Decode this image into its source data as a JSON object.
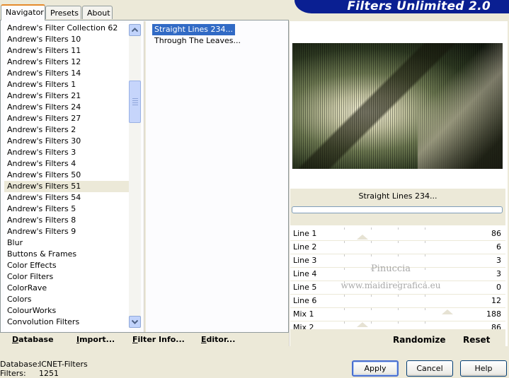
{
  "tabs": [
    {
      "label": "Navigator",
      "active": true
    },
    {
      "label": "Presets",
      "active": false
    },
    {
      "label": "About",
      "active": false
    }
  ],
  "banner_title": "Filters Unlimited 2.0",
  "categories": [
    "Andrew's Filter Collection 62",
    "Andrew's Filters 10",
    "Andrew's Filters 11",
    "Andrew's Filters 12",
    "Andrew's Filters 14",
    "Andrew's Filters 1",
    "Andrew's Filters 21",
    "Andrew's Filters 24",
    "Andrew's Filters 27",
    "Andrew's Filters 2",
    "Andrew's Filters 30",
    "Andrew's Filters 3",
    "Andrew's Filters 4",
    "Andrew's Filters 50",
    "Andrew's Filters 51",
    "Andrew's Filters 54",
    "Andrew's Filters 5",
    "Andrew's Filters 8",
    "Andrew's Filters 9",
    "Blur",
    "Buttons & Frames",
    "Color Effects",
    "Color Filters",
    "ColorRave",
    "Colors",
    "ColourWorks",
    "Convolution Filters"
  ],
  "selected_category": "Andrew's Filters 51",
  "filters": [
    "Straight Lines 234...",
    "Through The Leaves..."
  ],
  "selected_filter": "Straight Lines 234...",
  "toolbar": {
    "database": "Database",
    "import": "Import...",
    "filter_info": "Filter Info...",
    "editor": "Editor..."
  },
  "preview_filter_name": "Straight Lines 234...",
  "params": [
    {
      "label": "Line 1",
      "value": "86"
    },
    {
      "label": "Line 2",
      "value": "6"
    },
    {
      "label": "Line 3",
      "value": "3"
    },
    {
      "label": "Line 4",
      "value": "3"
    },
    {
      "label": "Line 5",
      "value": "0"
    },
    {
      "label": "Line 6",
      "value": "12"
    },
    {
      "label": "Mix 1",
      "value": "188"
    },
    {
      "label": "Mix 2",
      "value": "86"
    }
  ],
  "watermark": {
    "line1": "Pinuccia",
    "line2": "www.maidiregrafica.eu"
  },
  "randomize_label": "Randomize",
  "reset_label": "Reset",
  "status": {
    "database_label": "Database:",
    "database_value": "ICNET-Filters",
    "filters_label": "Filters:",
    "filters_value": "1251"
  },
  "buttons": {
    "apply": "Apply",
    "cancel": "Cancel",
    "help": "Help"
  },
  "colors": {
    "banner": "#0A1F92",
    "selection": "#316AC5",
    "face": "#ECE9D8"
  }
}
